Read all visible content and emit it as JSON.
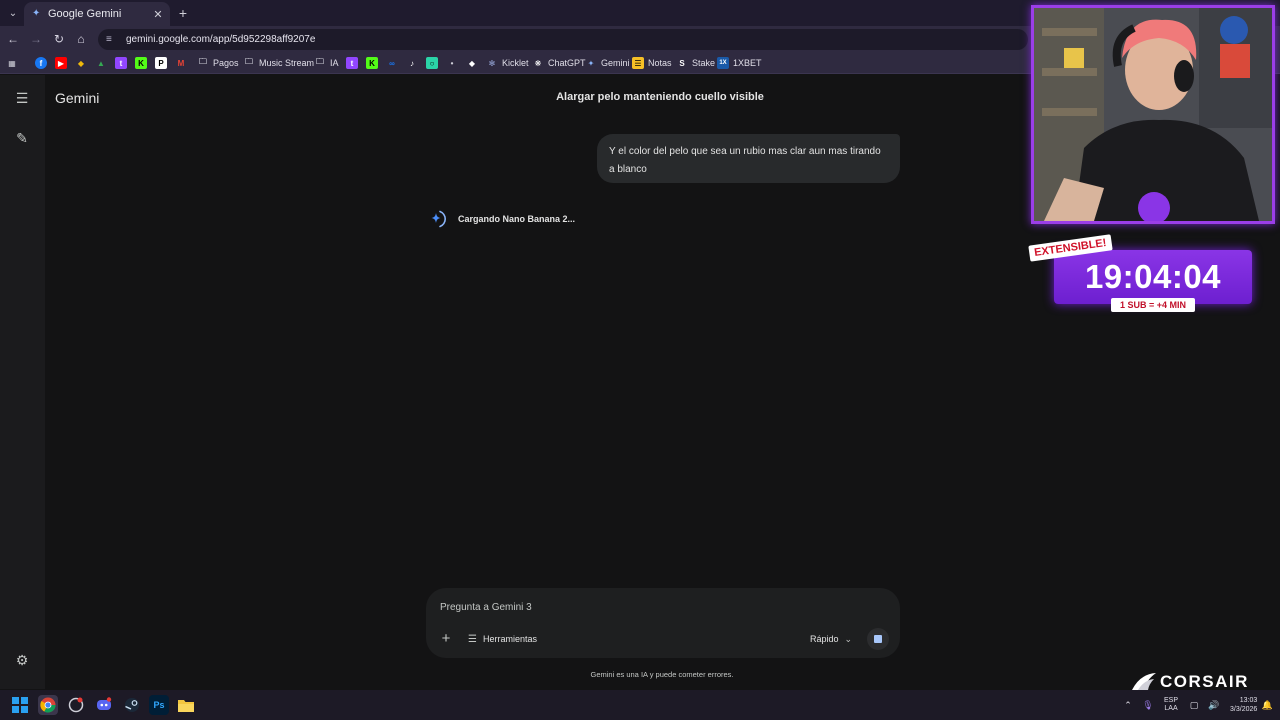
{
  "browser": {
    "tab_title": "Google Gemini",
    "url": "gemini.google.com/app/5d952298aff9207e",
    "bookmarks": [
      {
        "label": "Pagos",
        "icon": "folder-icon"
      },
      {
        "label": "Music Stream",
        "icon": "folder-icon"
      },
      {
        "label": "IA",
        "icon": "folder-icon"
      },
      {
        "label": "Kicklet",
        "icon": "kicklet-icon"
      },
      {
        "label": "ChatGPT",
        "icon": "chatgpt-icon"
      },
      {
        "label": "Gemini",
        "icon": "gemini-icon"
      },
      {
        "label": "Notas",
        "icon": "notes-icon"
      },
      {
        "label": "Stake",
        "icon": "stake-icon"
      },
      {
        "label": "1XBET",
        "icon": "1xbet-icon"
      }
    ]
  },
  "app": {
    "brand": "Gemini",
    "conversation_title": "Alargar pelo manteniendo cuello visible",
    "user_message": "Y el color del pelo que sea un rubio mas clar aun mas tirando a blanco",
    "status_text": "Cargando Nano Banana 2...",
    "composer": {
      "placeholder": "Pregunta a Gemini 3",
      "tools_label": "Herramientas",
      "mode_label": "Rápido"
    },
    "disclaimer": "Gemini es una IA y puede cometer errores."
  },
  "overlay": {
    "timer": "19:04:04",
    "extensible_label": "EXTENSIBLE!",
    "sub_rate": "1 SUB = +4 MIN",
    "sponsor": "CORSAIR"
  },
  "taskbar": {
    "lang_top": "ESP",
    "lang_bottom": "LAA",
    "time": "13:03",
    "date": "3/3/2026"
  }
}
